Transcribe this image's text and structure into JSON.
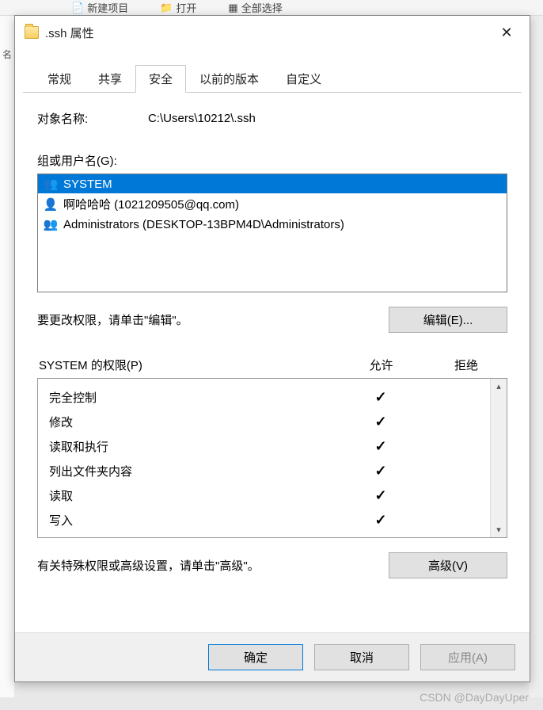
{
  "bg_toolbar": {
    "new_project": "新建项目",
    "open": "打开",
    "select_all": "全部选择"
  },
  "bg_sidebar_label": "名",
  "dialog": {
    "title": ".ssh 属性",
    "tabs": [
      "常规",
      "共享",
      "安全",
      "以前的版本",
      "自定义"
    ],
    "active_tab_index": 2,
    "object_label": "对象名称:",
    "object_value": "C:\\Users\\10212\\.ssh",
    "group_label": "组或用户名(G):",
    "users": [
      {
        "name": "SYSTEM",
        "icon": "group",
        "selected": true
      },
      {
        "name": "啊哈哈哈 (1021209505@qq.com)",
        "icon": "user",
        "selected": false
      },
      {
        "name": "Administrators (DESKTOP-13BPM4D\\Administrators)",
        "icon": "admins",
        "selected": false
      }
    ],
    "edit_text": "要更改权限，请单击\"编辑\"。",
    "edit_button": "编辑(E)...",
    "perm_label": "SYSTEM 的权限(P)",
    "perm_header_allow": "允许",
    "perm_header_deny": "拒绝",
    "permissions": [
      {
        "name": "完全控制",
        "allow": true,
        "deny": false
      },
      {
        "name": "修改",
        "allow": true,
        "deny": false
      },
      {
        "name": "读取和执行",
        "allow": true,
        "deny": false
      },
      {
        "name": "列出文件夹内容",
        "allow": true,
        "deny": false
      },
      {
        "name": "读取",
        "allow": true,
        "deny": false
      },
      {
        "name": "写入",
        "allow": true,
        "deny": false
      }
    ],
    "adv_text": "有关特殊权限或高级设置，请单击\"高级\"。",
    "adv_button": "高级(V)",
    "footer": {
      "ok": "确定",
      "cancel": "取消",
      "apply": "应用(A)"
    }
  },
  "watermark": "CSDN @DayDayUper"
}
